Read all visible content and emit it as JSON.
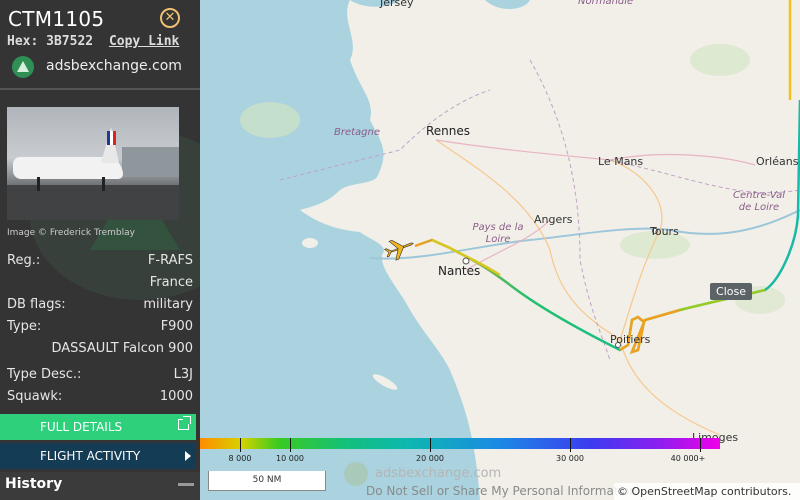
{
  "aircraft": {
    "callsign": "CTM1105",
    "hex_label": "Hex:",
    "hex": "3B7522",
    "copy_link_label": "Copy Link",
    "site_name": "adsbexchange.com",
    "photo_credit": "Image © Frederick Tremblay"
  },
  "details": [
    {
      "label": "Reg.:",
      "value": "F-RAFS"
    },
    {
      "label": "",
      "value": "France"
    },
    {
      "label": "DB flags:",
      "value": "military"
    },
    {
      "label": "Type:",
      "value": "F900"
    },
    {
      "label": "",
      "value": "DASSAULT Falcon 900"
    },
    {
      "label": "Type Desc.:",
      "value": "L3J"
    },
    {
      "label": "Squawk:",
      "value": "1000"
    }
  ],
  "buttons": {
    "full_details": "FULL DETAILS",
    "flight_activity": "FLIGHT ACTIVITY",
    "history": "History"
  },
  "map": {
    "cities": [
      "Jersey",
      "Normandie",
      "Rennes",
      "Le Mans",
      "Orléans",
      "Angers",
      "Tours",
      "Nantes",
      "Poitiers",
      "Limoges"
    ],
    "regions": [
      "Bretagne",
      "Pays de la Loire",
      "Centre-Val de Loire"
    ],
    "close_tooltip": "Close",
    "scale_label": "50 NM",
    "watermark": "adsbexchange.com",
    "privacy_link": "Do Not Sell or Share My Personal Information",
    "attribution": "© OpenStreetMap contributors."
  },
  "altitude_legend": {
    "labels": [
      "8 000",
      "10 000",
      "20 000",
      "30 000",
      "40 000+"
    ],
    "ticks_ft": [
      8000,
      10000,
      20000,
      30000,
      40000
    ]
  },
  "colors": {
    "sidebar_bg": "#343434",
    "full_details_bg": "#2ed07c",
    "flight_activity_bg": "#143c55",
    "aircraft_icon": "#f0b41e",
    "close_icon": "#f0c070"
  }
}
